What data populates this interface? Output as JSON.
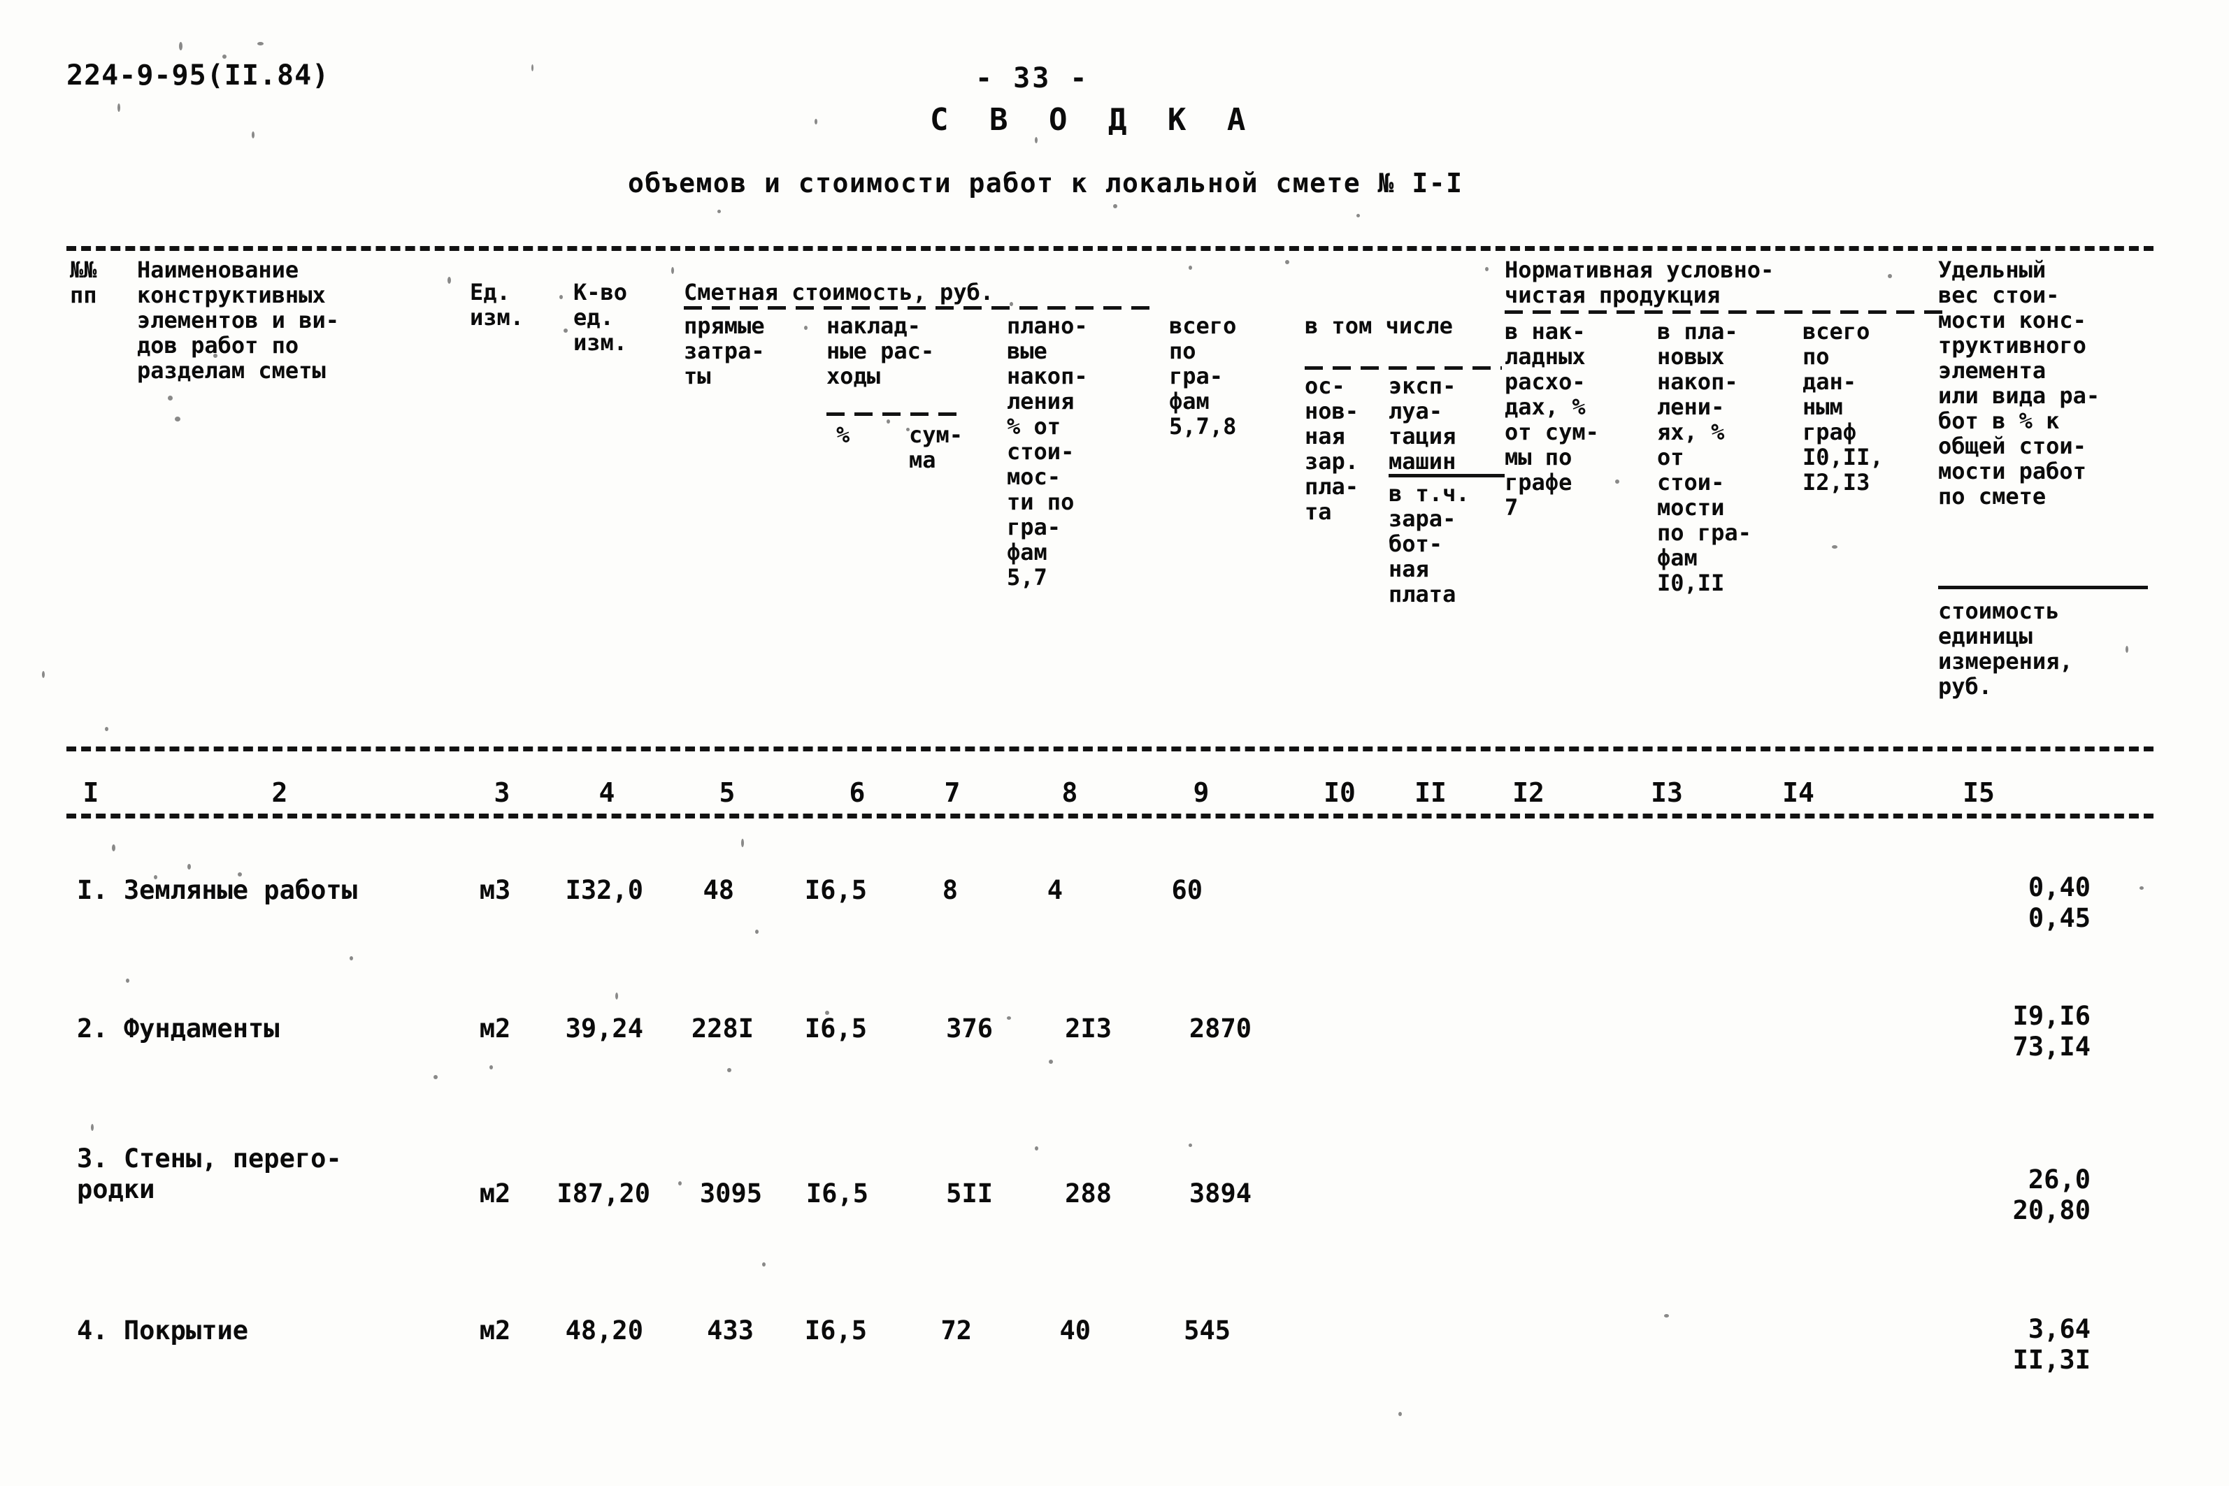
{
  "document": {
    "code": "224-9-95(II.84)",
    "page_number": "- 33 -",
    "title": "С В О Д К А",
    "subtitle": "объемов и стоимости работ к локальной смете № I-I"
  },
  "header": {
    "group_smetnaya": "Сметная стоимость, руб.",
    "group_vtomchisle": "в том числе",
    "group_nchp": "Нормативная условно-\nчистая продукция",
    "col1": "№№\nпп",
    "col2": "Наименование\nконструктивных\nэлементов и ви-\nдов работ по\nразделам сметы",
    "col3": "Ед.\nизм.",
    "col4": "К-во\nед.\nизм.",
    "col5": "прямые\nзатра-\nты",
    "col6": "наклад-\nные рас-\nходы",
    "col6_sub_pct": "%",
    "col6_sub_sum": "сум-\nма",
    "col8": "плано-\nвые\nнакоп-\nления\n% от\nстои-\nмос-\nти по\nгра-\nфам\n5,7",
    "col9": "всего\nпо\nгра-\nфам\n5,7,8",
    "col10": "ос-\nнов-\nная\nзар.\nпла-\nта",
    "col11": "эксп-\nлуа-\nтация\nмашин",
    "col11_sub": "в т.ч.\nзара-\nбот-\nная\nплата",
    "col12": "в нак-\nладных\nрасхо-\nдах, %\nот сум-\nмы по\nграфе\n7",
    "col13": "в пла-\nновых\nнакоп-\nлени-\nях, %\nот\nстои-\nмости\nпо гра-\nфам\nI0,II",
    "col14": "всего\nпо\nдан-\nным\nграф\nI0,II,\nI2,I3",
    "col15": "Удельный\nвес стои-\nмости конс-\nтруктивного\nэлемента\nили вида ра-\nбот в % к\nобщей стои-\nмости работ\nпо смете",
    "col15_sub": "стоимость\nединицы\nизмерения,\nруб."
  },
  "column_numbers": [
    "I",
    "2",
    "3",
    "4",
    "5",
    "6",
    "7",
    "8",
    "9",
    "I0",
    "II",
    "I2",
    "I3",
    "I4",
    "I5"
  ],
  "rows": [
    {
      "num_name": "I. Земляные работы",
      "unit": "м3",
      "qty": "I32,0",
      "direct": "48",
      "overhead_pct": "I6,5",
      "overhead_sum": "8",
      "planned_savings": "4",
      "total": "60",
      "c10": "",
      "c11": "",
      "c12": "",
      "c13": "",
      "c14": "",
      "share_pct": "0,40",
      "unit_cost": "0,45"
    },
    {
      "num_name": "2. Фундаменты",
      "unit": "м2",
      "qty": "39,24",
      "direct": "228I",
      "overhead_pct": "I6,5",
      "overhead_sum": "376",
      "planned_savings": "2I3",
      "total": "2870",
      "c10": "",
      "c11": "",
      "c12": "",
      "c13": "",
      "c14": "",
      "share_pct": "I9,I6",
      "unit_cost": "73,I4"
    },
    {
      "num_name": "3. Стены, перего-\n   родки",
      "unit": "м2",
      "qty": "I87,20",
      "direct": "3095",
      "overhead_pct": "I6,5",
      "overhead_sum": "5II",
      "planned_savings": "288",
      "total": "3894",
      "c10": "",
      "c11": "",
      "c12": "",
      "c13": "",
      "c14": "",
      "share_pct": "26,0",
      "unit_cost": "20,80"
    },
    {
      "num_name": "4. Покрытие",
      "unit": "м2",
      "qty": "48,20",
      "direct": "433",
      "overhead_pct": "I6,5",
      "overhead_sum": "72",
      "planned_savings": "40",
      "total": "545",
      "c10": "",
      "c11": "",
      "c12": "",
      "c13": "",
      "c14": "",
      "share_pct": "3,64",
      "unit_cost": "II,3I"
    }
  ]
}
